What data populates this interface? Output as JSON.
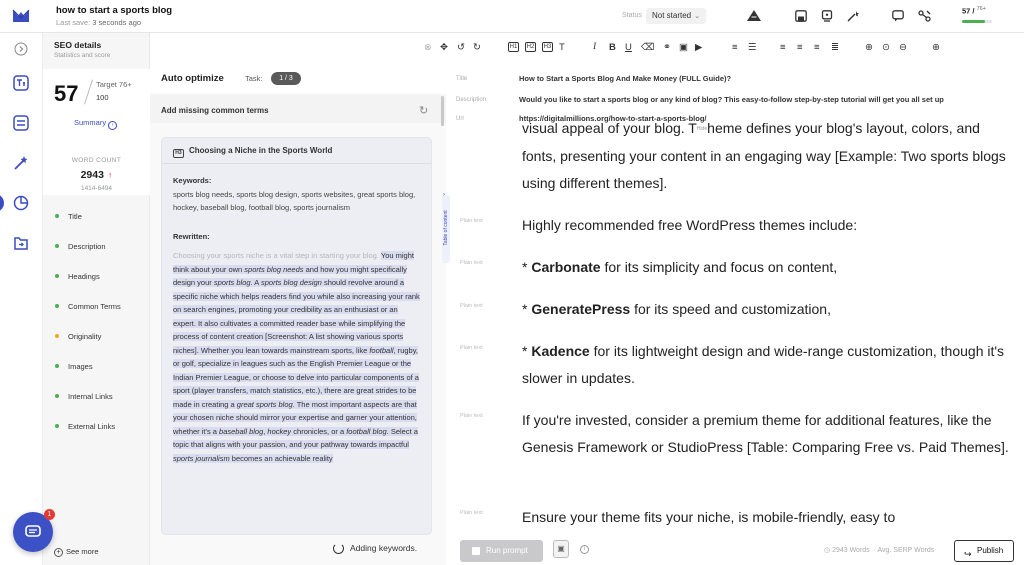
{
  "header": {
    "doc_title": "how to start a sports blog",
    "last_save_label": "Last save:",
    "last_save_value": "3 seconds ago",
    "status_label": "Status",
    "status_value": "Not started",
    "score": "57",
    "score_target": "76+",
    "score_progress": 0.75
  },
  "seo": {
    "title": "SEO details",
    "subtitle": "Statistics and score",
    "score": "57",
    "target_label": "Target 76+",
    "target_max": "100",
    "summary_label": "Summary",
    "word_count_label": "WORD COUNT",
    "word_count": "2943",
    "word_range": "1414-6494",
    "items": [
      {
        "label": "Title",
        "color": "#4caf50"
      },
      {
        "label": "Description",
        "color": "#4caf50"
      },
      {
        "label": "Headings",
        "color": "#4caf50"
      },
      {
        "label": "Common Terms",
        "color": "#4caf50"
      },
      {
        "label": "Originality",
        "color": "#f5a623"
      },
      {
        "label": "Images",
        "color": "#4caf50"
      },
      {
        "label": "Internal Links",
        "color": "#4caf50"
      },
      {
        "label": "External Links",
        "color": "#4caf50"
      }
    ],
    "see_more": "See more",
    "chat_badge": "1"
  },
  "optimize": {
    "title": "Auto optimize",
    "task_label": "Task:",
    "task_value": "1 / 3",
    "missing_label": "Add missing common terms",
    "card_title": "Choosing a Niche in the Sports World",
    "keywords_label": "Keywords:",
    "keywords_text": "sports blog needs, sports blog design, sports websites, great sports blog, hockey, baseball blog, football blog, sports journalism",
    "rewritten_label": "Rewritten:",
    "rewritten_faded": "Choosing your sports niche is a vital step in starting your blog.",
    "rewritten_segments": [
      {
        "text": "You might think about your own ",
        "i": false
      },
      {
        "text": "sports blog needs",
        "i": true
      },
      {
        "text": " and how you might specifically design your ",
        "i": false
      },
      {
        "text": "sports blog",
        "i": true
      },
      {
        "text": ". A ",
        "i": false
      },
      {
        "text": "sports blog design",
        "i": true
      },
      {
        "text": " should revolve around a specific niche which helps readers find you while also increasing your rank on search engines, promoting your credibility as an enthusiast or an expert. It also cultivates a committed reader base while simplifying the process of content creation [Screenshot: A list showing various sports niches]. Whether you lean towards mainstream sports, like ",
        "i": false
      },
      {
        "text": "football",
        "i": true
      },
      {
        "text": ", rugby, or golf, specialize in leagues such as the English Premier League or the Indian Premier League, or choose to delve into particular components of a sport (player transfers, match statistics, etc.), there are great strides to be made in creating a ",
        "i": false
      },
      {
        "text": "great sports blog",
        "i": true
      },
      {
        "text": ". The most important aspects are that your chosen niche should mirror your expertise and garner your attention, whether it's a ",
        "i": false
      },
      {
        "text": "baseball blog",
        "i": true
      },
      {
        "text": ", ",
        "i": false
      },
      {
        "text": "hockey",
        "i": true
      },
      {
        "text": " chronicles, or a ",
        "i": false
      },
      {
        "text": "football blog",
        "i": true
      },
      {
        "text": ". Select a topic that aligns with your passion, and your pathway towards impactful ",
        "i": false
      },
      {
        "text": "sports journalism",
        "i": true
      },
      {
        "text": " becomes an achievable reality",
        "i": false
      }
    ],
    "adding_label": "Adding keywords."
  },
  "editor": {
    "meta": [
      {
        "label": "Title",
        "value": "How to Start a Sports Blog And Make Money (FULL Guide)?"
      },
      {
        "label": "Description",
        "value": "Would you like to start a sports blog or any kind of blog? This easy-to-follow step-by-step tutorial will get you all set up"
      },
      {
        "label": "Url",
        "value": "https://digitalmillions.org/how-to-start-a-sports-blog/"
      }
    ],
    "plain_text_label": "Plain text",
    "toc_label": "Table of content",
    "hide_label": "Hide",
    "p0_a": "visual appeal of your blog. T",
    "p0_b": "heme defines your blog's layout,",
    "p0_c": "colors, and fonts, presenting your content in an engaging way [Example: Two sports blogs using different themes].",
    "p1": "Highly recommended free WordPress themes include:",
    "themes": [
      {
        "prefix": "* ",
        "name": "Carbonate",
        "rest": " for its simplicity and focus on content,"
      },
      {
        "prefix": "* ",
        "name": "GeneratePress",
        "rest": " for its speed and customization,"
      },
      {
        "prefix": "* ",
        "name": "Kadence",
        "rest": " for its lightweight design and wide-range customization, though it's slower in updates."
      }
    ],
    "p5": "If you're invested, consider a premium theme for additional features, like the Genesis Framework or StudioPress [Table: Comparing Free vs. Paid Themes].",
    "p6": "Ensure your theme fits your niche, is mobile-friendly, easy to"
  },
  "footer": {
    "run_prompt": "Run prompt",
    "words": "2943 Words",
    "avg": "Avg. SERP Words",
    "publish": "Publish"
  }
}
